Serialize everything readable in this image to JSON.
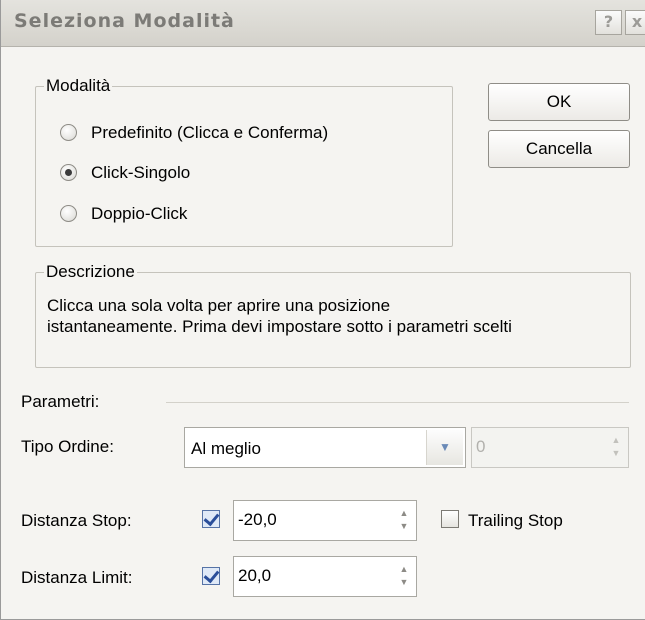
{
  "window": {
    "title": "Seleziona Modalità",
    "help_label": "?",
    "close_label": "x"
  },
  "modes": {
    "legend": "Modalità",
    "options": [
      {
        "label": "Predefinito (Clicca e Conferma)",
        "checked": false
      },
      {
        "label": "Click-Singolo",
        "checked": true
      },
      {
        "label": "Doppio-Click",
        "checked": false
      }
    ]
  },
  "buttons": {
    "ok_label": "OK",
    "cancel_label": "Cancella"
  },
  "description": {
    "legend": "Descrizione",
    "line1": "Clicca una sola volta per aprire una posizione",
    "line2": "istantaneamente. Prima devi impostare sotto i parametri scelti"
  },
  "parameters": {
    "section_label": "Parametri:",
    "order_type": {
      "label": "Tipo Ordine:",
      "value": "Al meglio",
      "dropdown_icon": "chevron-down-icon"
    },
    "order_qty": {
      "value": "0",
      "enabled": false
    },
    "stop_distance": {
      "label": "Distanza Stop:",
      "checked": true,
      "value": "-20,0"
    },
    "trailing_stop": {
      "label": "Trailing Stop",
      "checked": false
    },
    "limit_distance": {
      "label": "Distanza Limit:",
      "checked": true,
      "value": "20,0"
    },
    "spin_up_glyph": "▲",
    "spin_down_glyph": "▼",
    "dropdown_glyph": "▼"
  }
}
